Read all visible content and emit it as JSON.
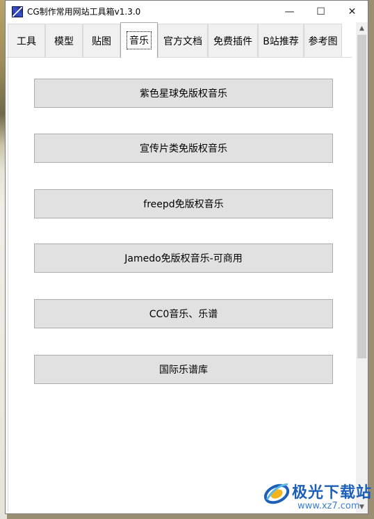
{
  "window": {
    "title": "CG制作常用网站工具箱v1.3.0",
    "minimize_glyph": "—",
    "maximize_glyph": "☐",
    "close_glyph": "✕"
  },
  "tabs": [
    {
      "label": "工具",
      "active": false
    },
    {
      "label": "模型",
      "active": false
    },
    {
      "label": "贴图",
      "active": false
    },
    {
      "label": "音乐",
      "active": true
    },
    {
      "label": "官方文档",
      "active": false
    },
    {
      "label": "免费插件",
      "active": false
    },
    {
      "label": "B站推荐",
      "active": false
    },
    {
      "label": "参考图",
      "active": false
    }
  ],
  "buttons": [
    {
      "label": "紫色星球免版权音乐"
    },
    {
      "label": "宣传片类免版权音乐"
    },
    {
      "label": "freepd免版权音乐"
    },
    {
      "label": "Jamedo免版权音乐-可商用"
    },
    {
      "label": "CC0音乐、乐谱"
    },
    {
      "label": "国际乐谱库"
    }
  ],
  "scrollbar": {
    "up_glyph": "▲",
    "down_glyph": "▼"
  },
  "watermark": {
    "brand": "极光下载站",
    "url": "www.xz7.com"
  },
  "colors": {
    "button_bg": "#e1e1e1",
    "tab_bg": "#f0f0f0",
    "watermark": "#1d5fb8"
  }
}
